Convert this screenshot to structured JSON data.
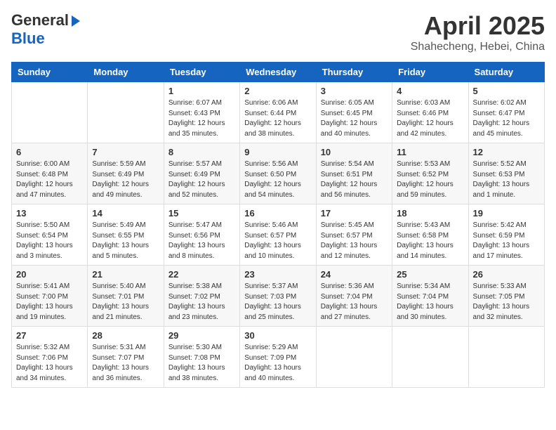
{
  "logo": {
    "general": "General",
    "blue": "Blue"
  },
  "title": {
    "month": "April 2025",
    "location": "Shahecheng, Hebei, China"
  },
  "weekdays": [
    "Sunday",
    "Monday",
    "Tuesday",
    "Wednesday",
    "Thursday",
    "Friday",
    "Saturday"
  ],
  "weeks": [
    [
      {
        "day": "",
        "info": ""
      },
      {
        "day": "",
        "info": ""
      },
      {
        "day": "1",
        "info": "Sunrise: 6:07 AM\nSunset: 6:43 PM\nDaylight: 12 hours\nand 35 minutes."
      },
      {
        "day": "2",
        "info": "Sunrise: 6:06 AM\nSunset: 6:44 PM\nDaylight: 12 hours\nand 38 minutes."
      },
      {
        "day": "3",
        "info": "Sunrise: 6:05 AM\nSunset: 6:45 PM\nDaylight: 12 hours\nand 40 minutes."
      },
      {
        "day": "4",
        "info": "Sunrise: 6:03 AM\nSunset: 6:46 PM\nDaylight: 12 hours\nand 42 minutes."
      },
      {
        "day": "5",
        "info": "Sunrise: 6:02 AM\nSunset: 6:47 PM\nDaylight: 12 hours\nand 45 minutes."
      }
    ],
    [
      {
        "day": "6",
        "info": "Sunrise: 6:00 AM\nSunset: 6:48 PM\nDaylight: 12 hours\nand 47 minutes."
      },
      {
        "day": "7",
        "info": "Sunrise: 5:59 AM\nSunset: 6:49 PM\nDaylight: 12 hours\nand 49 minutes."
      },
      {
        "day": "8",
        "info": "Sunrise: 5:57 AM\nSunset: 6:49 PM\nDaylight: 12 hours\nand 52 minutes."
      },
      {
        "day": "9",
        "info": "Sunrise: 5:56 AM\nSunset: 6:50 PM\nDaylight: 12 hours\nand 54 minutes."
      },
      {
        "day": "10",
        "info": "Sunrise: 5:54 AM\nSunset: 6:51 PM\nDaylight: 12 hours\nand 56 minutes."
      },
      {
        "day": "11",
        "info": "Sunrise: 5:53 AM\nSunset: 6:52 PM\nDaylight: 12 hours\nand 59 minutes."
      },
      {
        "day": "12",
        "info": "Sunrise: 5:52 AM\nSunset: 6:53 PM\nDaylight: 13 hours\nand 1 minute."
      }
    ],
    [
      {
        "day": "13",
        "info": "Sunrise: 5:50 AM\nSunset: 6:54 PM\nDaylight: 13 hours\nand 3 minutes."
      },
      {
        "day": "14",
        "info": "Sunrise: 5:49 AM\nSunset: 6:55 PM\nDaylight: 13 hours\nand 5 minutes."
      },
      {
        "day": "15",
        "info": "Sunrise: 5:47 AM\nSunset: 6:56 PM\nDaylight: 13 hours\nand 8 minutes."
      },
      {
        "day": "16",
        "info": "Sunrise: 5:46 AM\nSunset: 6:57 PM\nDaylight: 13 hours\nand 10 minutes."
      },
      {
        "day": "17",
        "info": "Sunrise: 5:45 AM\nSunset: 6:57 PM\nDaylight: 13 hours\nand 12 minutes."
      },
      {
        "day": "18",
        "info": "Sunrise: 5:43 AM\nSunset: 6:58 PM\nDaylight: 13 hours\nand 14 minutes."
      },
      {
        "day": "19",
        "info": "Sunrise: 5:42 AM\nSunset: 6:59 PM\nDaylight: 13 hours\nand 17 minutes."
      }
    ],
    [
      {
        "day": "20",
        "info": "Sunrise: 5:41 AM\nSunset: 7:00 PM\nDaylight: 13 hours\nand 19 minutes."
      },
      {
        "day": "21",
        "info": "Sunrise: 5:40 AM\nSunset: 7:01 PM\nDaylight: 13 hours\nand 21 minutes."
      },
      {
        "day": "22",
        "info": "Sunrise: 5:38 AM\nSunset: 7:02 PM\nDaylight: 13 hours\nand 23 minutes."
      },
      {
        "day": "23",
        "info": "Sunrise: 5:37 AM\nSunset: 7:03 PM\nDaylight: 13 hours\nand 25 minutes."
      },
      {
        "day": "24",
        "info": "Sunrise: 5:36 AM\nSunset: 7:04 PM\nDaylight: 13 hours\nand 27 minutes."
      },
      {
        "day": "25",
        "info": "Sunrise: 5:34 AM\nSunset: 7:04 PM\nDaylight: 13 hours\nand 30 minutes."
      },
      {
        "day": "26",
        "info": "Sunrise: 5:33 AM\nSunset: 7:05 PM\nDaylight: 13 hours\nand 32 minutes."
      }
    ],
    [
      {
        "day": "27",
        "info": "Sunrise: 5:32 AM\nSunset: 7:06 PM\nDaylight: 13 hours\nand 34 minutes."
      },
      {
        "day": "28",
        "info": "Sunrise: 5:31 AM\nSunset: 7:07 PM\nDaylight: 13 hours\nand 36 minutes."
      },
      {
        "day": "29",
        "info": "Sunrise: 5:30 AM\nSunset: 7:08 PM\nDaylight: 13 hours\nand 38 minutes."
      },
      {
        "day": "30",
        "info": "Sunrise: 5:29 AM\nSunset: 7:09 PM\nDaylight: 13 hours\nand 40 minutes."
      },
      {
        "day": "",
        "info": ""
      },
      {
        "day": "",
        "info": ""
      },
      {
        "day": "",
        "info": ""
      }
    ]
  ]
}
